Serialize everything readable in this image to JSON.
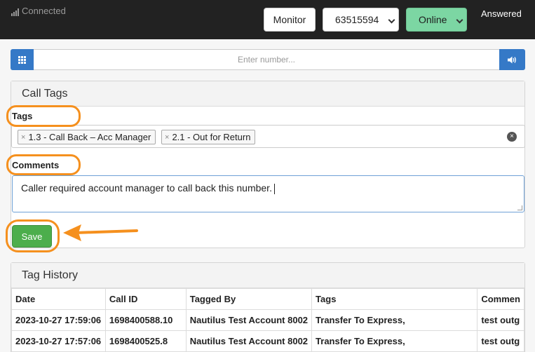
{
  "topbar": {
    "connection_status": "Connected",
    "monitor_label": "Monitor",
    "extension_value": "63515594",
    "status_value": "Online",
    "call_state": "Answered"
  },
  "dialpad": {
    "placeholder": "Enter number..."
  },
  "call_tags": {
    "title": "Call Tags",
    "tags_label": "Tags",
    "tags": [
      {
        "label": "1.3 - Call Back – Acc Manager"
      },
      {
        "label": "2.1 - Out for Return"
      }
    ],
    "comments_label": "Comments",
    "comment_value": "Caller required account manager to call back this number.",
    "save_label": "Save"
  },
  "tag_history": {
    "title": "Tag History",
    "columns": [
      "Date",
      "Call ID",
      "Tagged By",
      "Tags",
      "Commen"
    ],
    "rows": [
      [
        "2023-10-27 17:59:06",
        "1698400588.10",
        "Nautilus Test Account 8002",
        "Transfer To Express,",
        "test outg"
      ],
      [
        "2023-10-27 17:57:06",
        "1698400525.8",
        "Nautilus Test Account 8002",
        "Transfer To Express,",
        "test outg"
      ]
    ]
  },
  "colors": {
    "accent_blue": "#3579c7",
    "online_green": "#7cd6a3",
    "save_green": "#4cae4c",
    "highlight_orange": "#f5901e",
    "topbar_bg": "#222222"
  }
}
